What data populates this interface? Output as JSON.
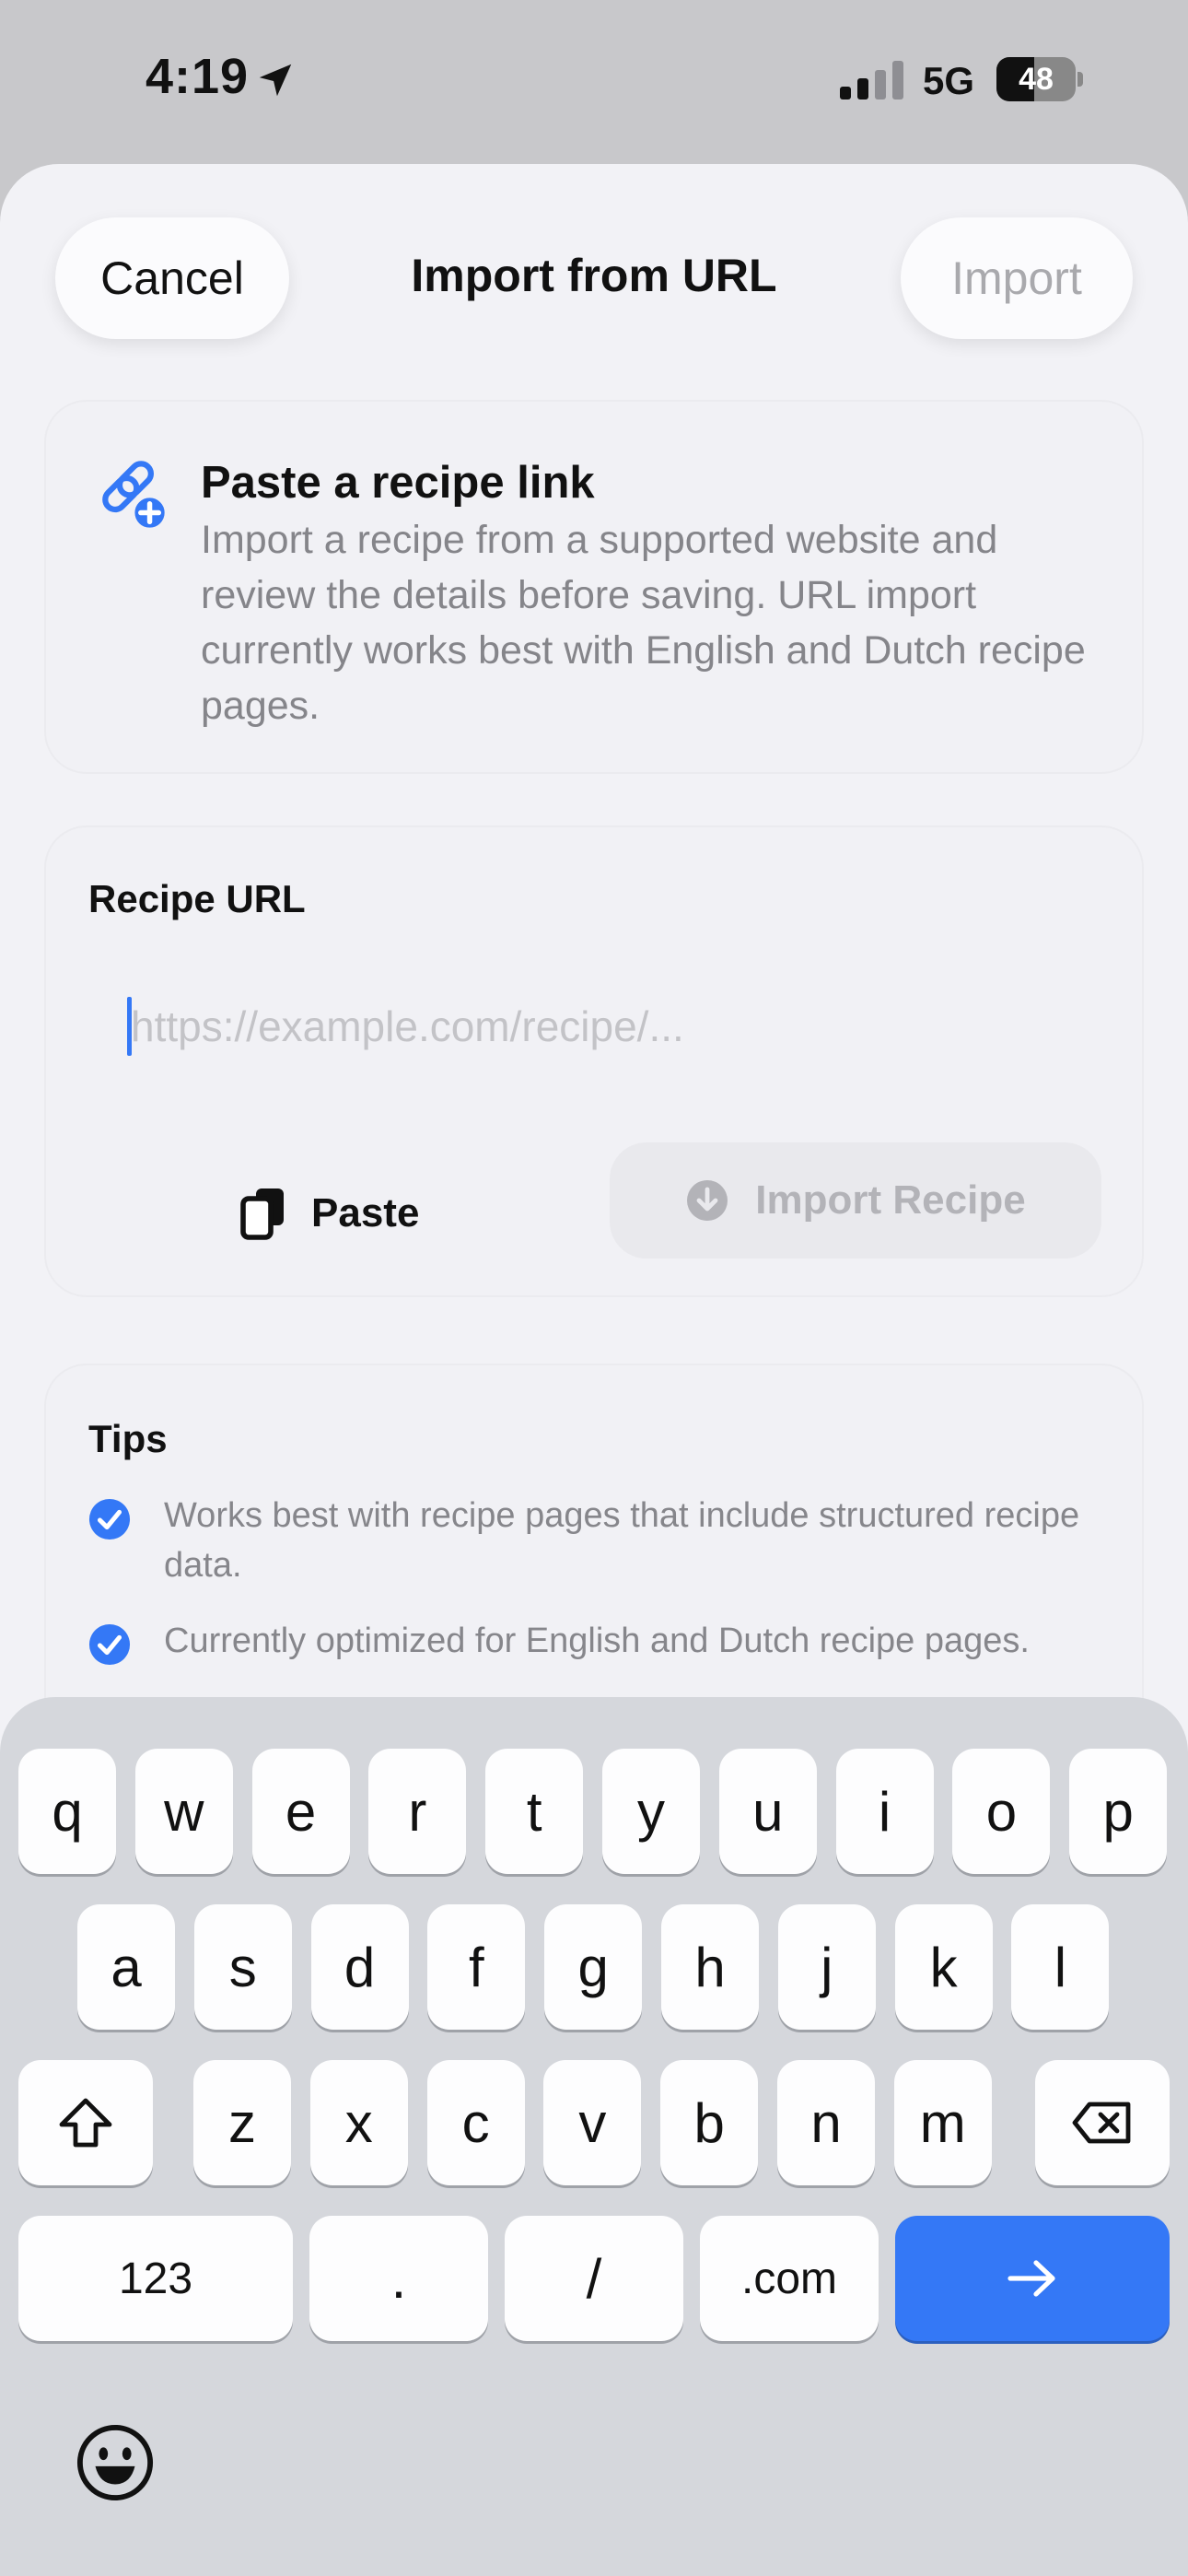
{
  "status_bar": {
    "time": "4:19",
    "network": "5G",
    "battery_percent": "48",
    "battery_level": 0.48,
    "icons": [
      "location-arrow-icon",
      "cellular-signal-icon",
      "battery-icon"
    ]
  },
  "nav": {
    "cancel_label": "Cancel",
    "title": "Import from URL",
    "import_label": "Import"
  },
  "info": {
    "icon": "link-plus-icon",
    "title": "Paste a recipe link",
    "body": "Import a recipe from a supported website and review the details before saving. URL import currently works best with English and Dutch recipe pages."
  },
  "url_section": {
    "label": "Recipe URL",
    "placeholder": "https://example.com/recipe/...",
    "value": "",
    "paste_label": "Paste",
    "paste_icon": "clipboard-icon",
    "import_recipe_label": "Import Recipe",
    "import_recipe_icon": "download-circle-icon"
  },
  "tips": {
    "label": "Tips",
    "items": [
      "Works best with recipe pages that include structured recipe data.",
      "Currently optimized for English and Dutch recipe pages."
    ]
  },
  "keyboard": {
    "row1": [
      "q",
      "w",
      "e",
      "r",
      "t",
      "y",
      "u",
      "i",
      "o",
      "p"
    ],
    "row2": [
      "a",
      "s",
      "d",
      "f",
      "g",
      "h",
      "j",
      "k",
      "l"
    ],
    "row3": [
      "z",
      "x",
      "c",
      "v",
      "b",
      "n",
      "m"
    ],
    "numbers_label": "123",
    "dot_label": ".",
    "slash_label": "/",
    "dotcom_label": ".com",
    "go_icon": "arrow-right-icon",
    "shift_icon": "shift-icon",
    "delete_icon": "delete-icon",
    "emoji_icon": "emoji-icon"
  },
  "colors": {
    "accent": "#3478f6",
    "sheet_background": "#f2f2f6",
    "secondary_text": "#86868b",
    "disabled_text": "#a9a9ad"
  }
}
